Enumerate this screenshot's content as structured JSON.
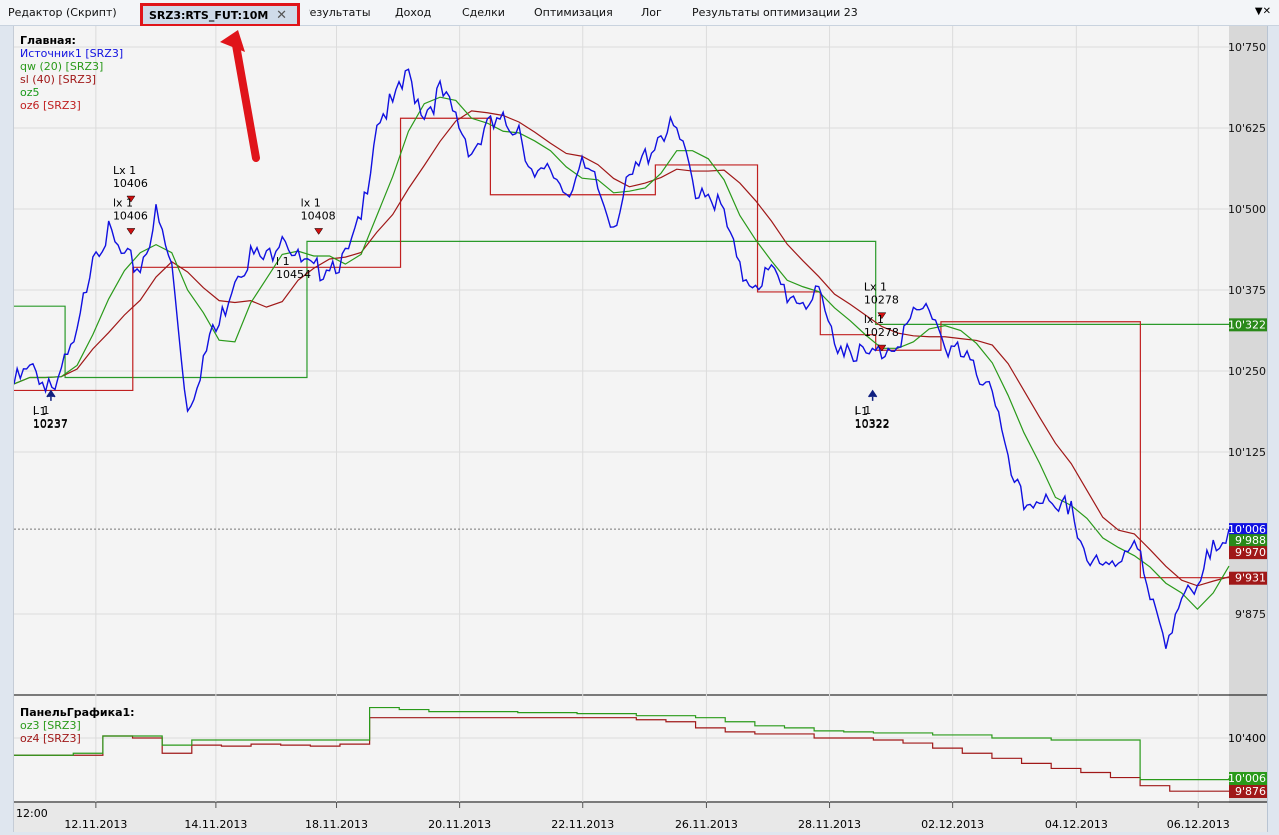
{
  "tabs": [
    {
      "label": "Редактор (Скрипт)"
    },
    {
      "label": "SRZ3:RTS_FUT:10M",
      "active": true
    },
    {
      "label": "Результаты"
    },
    {
      "label": "Доход"
    },
    {
      "label": "Сделки"
    },
    {
      "label": "Оптимизация"
    },
    {
      "label": "Лог"
    },
    {
      "label": "Результаты оптимизации 23"
    }
  ],
  "main_panel": {
    "title": "Главная:",
    "legend": [
      {
        "label": "Источник1 [SRZ3]",
        "color": "#1010e0"
      },
      {
        "label": "qw (20) [SRZ3]",
        "color": "#2a9a1a"
      },
      {
        "label": "sl (40) [SRZ3]",
        "color": "#a01818"
      },
      {
        "label": "oz5",
        "color": "#1a9a1a"
      },
      {
        "label": "oz6 [SRZ3]",
        "color": "#c02020"
      }
    ]
  },
  "sub_panel": {
    "title": "ПанельГрафика1:",
    "legend": [
      {
        "label": "oz3 [SRZ3]",
        "color": "#2a9a1a"
      },
      {
        "label": "oz4 [SRZ3]",
        "color": "#a01818"
      }
    ]
  },
  "chart_data": {
    "type": "line",
    "x_unit": "trading days",
    "x_range": [
      0,
      19.74
    ],
    "y_ticks": [
      "10'750",
      "10'625",
      "10'500",
      "10'375",
      "10'250",
      "10'125",
      "9'875"
    ],
    "y_tick_values": [
      10750,
      10625,
      10500,
      10375,
      10250,
      10125,
      9875
    ],
    "ylim": [
      9800,
      10780
    ],
    "x_ticks": [
      {
        "t": 1.33,
        "label": "12.11.2013"
      },
      {
        "t": 3.28,
        "label": "14.11.2013"
      },
      {
        "t": 5.24,
        "label": "18.11.2013"
      },
      {
        "t": 7.24,
        "label": "20.11.2013"
      },
      {
        "t": 9.24,
        "label": "22.11.2013"
      },
      {
        "t": 11.25,
        "label": "26.11.2013"
      },
      {
        "t": 13.25,
        "label": "28.11.2013"
      },
      {
        "t": 15.25,
        "label": "02.12.2013"
      },
      {
        "t": 17.26,
        "label": "04.12.2013"
      },
      {
        "t": 19.24,
        "label": "06.12.2013"
      }
    ],
    "time_label": "12:00",
    "price": [
      10230,
      10250,
      10240,
      10245,
      10300,
      10440,
      10460,
      10420,
      10410,
      10490,
      10410,
      10190,
      10270,
      10320,
      10400,
      10430,
      10420,
      10470,
      10420,
      10400,
      10420,
      10420,
      10480,
      10640,
      10660,
      10700,
      10650,
      10680,
      10640,
      10590,
      10620,
      10630,
      10630,
      10540,
      10560,
      10530,
      10560,
      10530,
      10480,
      10540,
      10580,
      10620,
      10620,
      10540,
      10530,
      10490,
      10400,
      10390,
      10400,
      10370,
      10360,
      10360,
      10300,
      10290,
      10270,
      10280,
      10300,
      10330,
      10350,
      10300,
      10270,
      10250,
      10230,
      10100,
      10040,
      10060,
      10020,
      10050,
      9960,
      9940,
      9960,
      10000,
      9890,
      9840,
      9900,
      9900,
      9990,
      10006
    ],
    "oz5_steps": [
      [
        0,
        10350
      ],
      [
        0.83,
        10240
      ],
      [
        4.76,
        10450
      ],
      [
        14.0,
        10322
      ]
    ],
    "oz6_steps": [
      [
        0,
        10220
      ],
      [
        1.93,
        10410
      ],
      [
        6.28,
        10640
      ],
      [
        7.74,
        10522
      ],
      [
        10.42,
        10568
      ],
      [
        12.08,
        10372
      ],
      [
        13.1,
        10306
      ],
      [
        14.0,
        10282
      ],
      [
        15.06,
        10326
      ],
      [
        18.3,
        9931
      ]
    ],
    "last_values": [
      {
        "label": "10'006",
        "color": "#1010e0"
      },
      {
        "label": "9'988",
        "color": "#2a8a1a"
      },
      {
        "label": "9'970",
        "color": "#a01818"
      },
      {
        "label": "9'931",
        "color": "#a01818"
      },
      {
        "label": "10'322",
        "color": "#2a8a1a"
      }
    ],
    "signals": [
      {
        "t": 0.6,
        "v": 10210,
        "dir": "up",
        "lines": [
          "l 1",
          "10237"
        ]
      },
      {
        "t": 0.6,
        "v": 10150,
        "dir": "none",
        "lines": [
          "L 1",
          "10237"
        ]
      },
      {
        "t": 1.9,
        "v": 10520,
        "dir": "down",
        "lines": [
          "Lx 1",
          "10406"
        ]
      },
      {
        "t": 1.9,
        "v": 10470,
        "dir": "down",
        "lines": [
          "lx 1",
          "10406"
        ]
      },
      {
        "t": 4.95,
        "v": 10470,
        "dir": "down",
        "lines": [
          "lx 1",
          "10408"
        ]
      },
      {
        "t": 4.55,
        "v": 10380,
        "dir": "none",
        "lines": [
          "l 1",
          "10454"
        ]
      },
      {
        "t": 14.1,
        "v": 10340,
        "dir": "down",
        "lines": [
          "Lx 1",
          "10278"
        ]
      },
      {
        "t": 14.1,
        "v": 10290,
        "dir": "down",
        "lines": [
          "lx 1",
          "10278"
        ]
      },
      {
        "t": 13.95,
        "v": 10210,
        "dir": "up",
        "lines": [
          "l 1",
          "10322"
        ]
      },
      {
        "t": 13.95,
        "v": 10150,
        "dir": "none",
        "lines": [
          "L 1",
          "10322"
        ]
      }
    ],
    "sub": {
      "y_ticks": [
        "10'400"
      ],
      "y_tick_values": [
        10400
      ],
      "ylim": [
        9830,
        10760
      ],
      "oz3": [
        10230,
        10230,
        10250,
        10420,
        10420,
        10330,
        10380,
        10380,
        10380,
        10380,
        10380,
        10380,
        10700,
        10680,
        10660,
        10660,
        10660,
        10650,
        10650,
        10640,
        10640,
        10620,
        10620,
        10600,
        10560,
        10520,
        10500,
        10470,
        10460,
        10450,
        10450,
        10430,
        10430,
        10400,
        10400,
        10380,
        10380,
        10380,
        9990,
        9990,
        9990,
        10006
      ],
      "oz4": [
        10230,
        10230,
        10230,
        10420,
        10400,
        10250,
        10330,
        10320,
        10340,
        10330,
        10320,
        10340,
        10600,
        10600,
        10600,
        10600,
        10600,
        10600,
        10600,
        10600,
        10600,
        10580,
        10560,
        10500,
        10460,
        10440,
        10440,
        10400,
        10400,
        10380,
        10350,
        10300,
        10250,
        10200,
        10150,
        10100,
        10060,
        10010,
        9930,
        9876,
        9876,
        9876
      ],
      "last_values": [
        {
          "label": "10'006",
          "color": "#2a9a1a"
        },
        {
          "label": "9'876",
          "color": "#a01818"
        }
      ]
    }
  }
}
